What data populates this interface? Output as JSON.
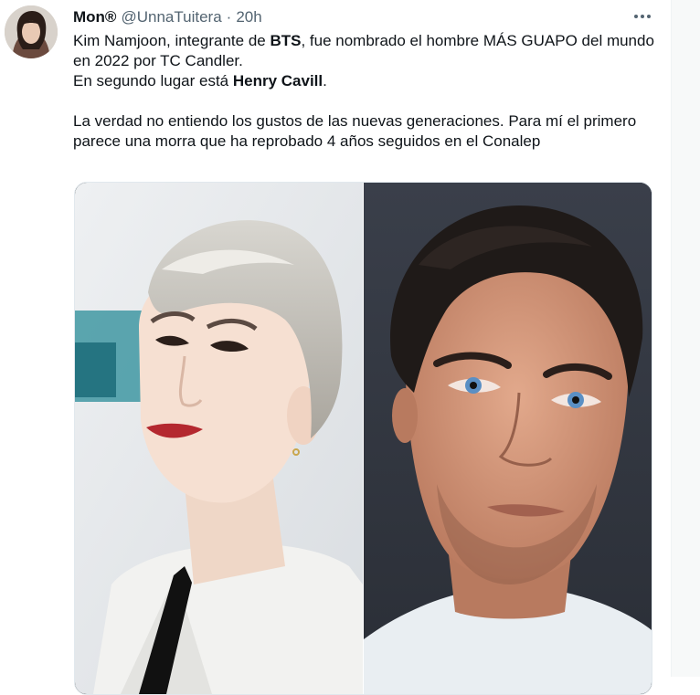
{
  "tweet": {
    "display_name": "Mon®",
    "handle": "@UnnaTuitera",
    "separator": "·",
    "timestamp": "20h",
    "more_icon": "more-horizontal-icon",
    "text": {
      "line1_pre": "Kim Namjoon, integrante de ",
      "line1_bold": "BTS",
      "line1_post": ", fue nombrado el hombre MÁS GUAPO del mundo en 2022 por TC Candler.",
      "line2_pre": "En segundo lugar está ",
      "line2_bold": "Henry Cavill",
      "line2_post": ".",
      "paragraph2": "La verdad no entiendo los gustos de las nuevas generaciones. Para mí el primero parece una morra que ha reprobado 4 años seguidos en el Conalep"
    }
  },
  "colors": {
    "text_primary": "#0f1419",
    "text_secondary": "#536471",
    "border": "#eff3f4",
    "background": "#ffffff"
  }
}
